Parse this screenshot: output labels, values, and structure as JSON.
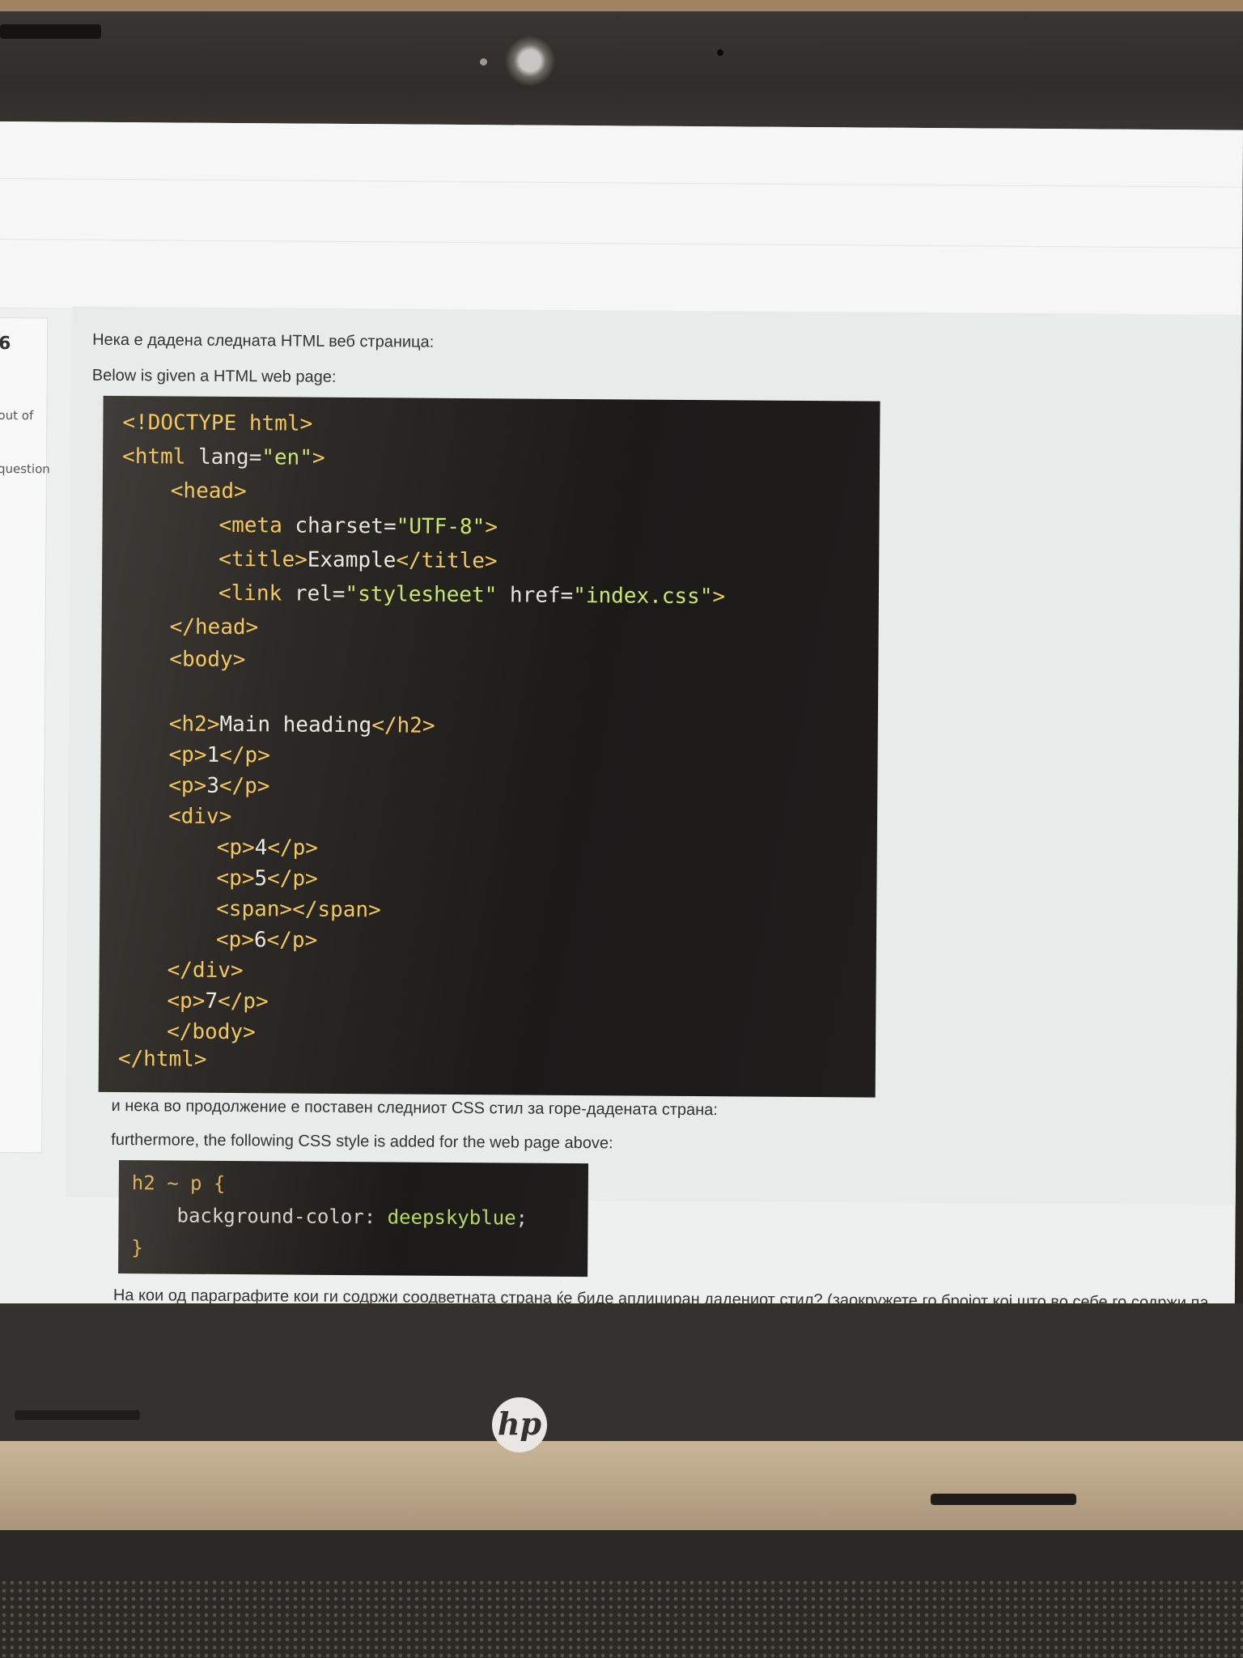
{
  "question": {
    "number": "6",
    "side_marks": "out of",
    "side_flag": "question",
    "intro_mk": "Нека е дадена следната HTML веб страница:",
    "intro_en": "Below is given a HTML web page:",
    "css_intro_mk": "и нека во продолжение е поставен следниот CSS стил за горе-дадената страна:",
    "css_intro_en": "furthermore, the following CSS style is added for the web page above:",
    "question_mk": "На кои од параграфите кои ги содржи соодветната страна ќе биде аплициран дадениот стил? (заокружете го бројот кој што во себе го содржи па"
  },
  "html_code": {
    "l1": "<!DOCTYPE html>",
    "l2_tag_open": "<html ",
    "l2_attr": "lang=",
    "l2_val": "\"en\"",
    "l2_close": ">",
    "l3": "<head>",
    "l4_tag": "<meta ",
    "l4_attr": "charset=",
    "l4_val": "\"UTF-8\"",
    "l4_close": ">",
    "l5_open": "<title>",
    "l5_text": "Example",
    "l5_close": "</title>",
    "l6_tag": "<link ",
    "l6_attr1": "rel=",
    "l6_val1": "\"stylesheet\"",
    "l6_attr2": " href=",
    "l6_val2": "\"index.css\"",
    "l6_close": ">",
    "l7": "</head>",
    "l8": "<body>",
    "l9_open": "<h2>",
    "l9_text": "Main heading",
    "l9_close": "</h2>",
    "l10_open": "<p>",
    "l10_text": "1",
    "l10_close": "</p>",
    "l11_open": "<p>",
    "l11_text": "3",
    "l11_close": "</p>",
    "l12": "<div>",
    "l13_open": "<p>",
    "l13_text": "4",
    "l13_close": "</p>",
    "l14_open": "<p>",
    "l14_text": "5",
    "l14_close": "</p>",
    "l15": "<span></span>",
    "l16_open": "<p>",
    "l16_text": "6",
    "l16_close": "</p>",
    "l17": "</div>",
    "l18_open": "<p>",
    "l18_text": "7",
    "l18_close": "</p>",
    "l19": "</body>",
    "l20": "</html>"
  },
  "css_code": {
    "selector": "h2 ~ p {",
    "property": "background-color: ",
    "value": "deepskyblue",
    "semicolon": ";",
    "close": "}"
  },
  "laptop": {
    "brand_logo": "hp"
  }
}
